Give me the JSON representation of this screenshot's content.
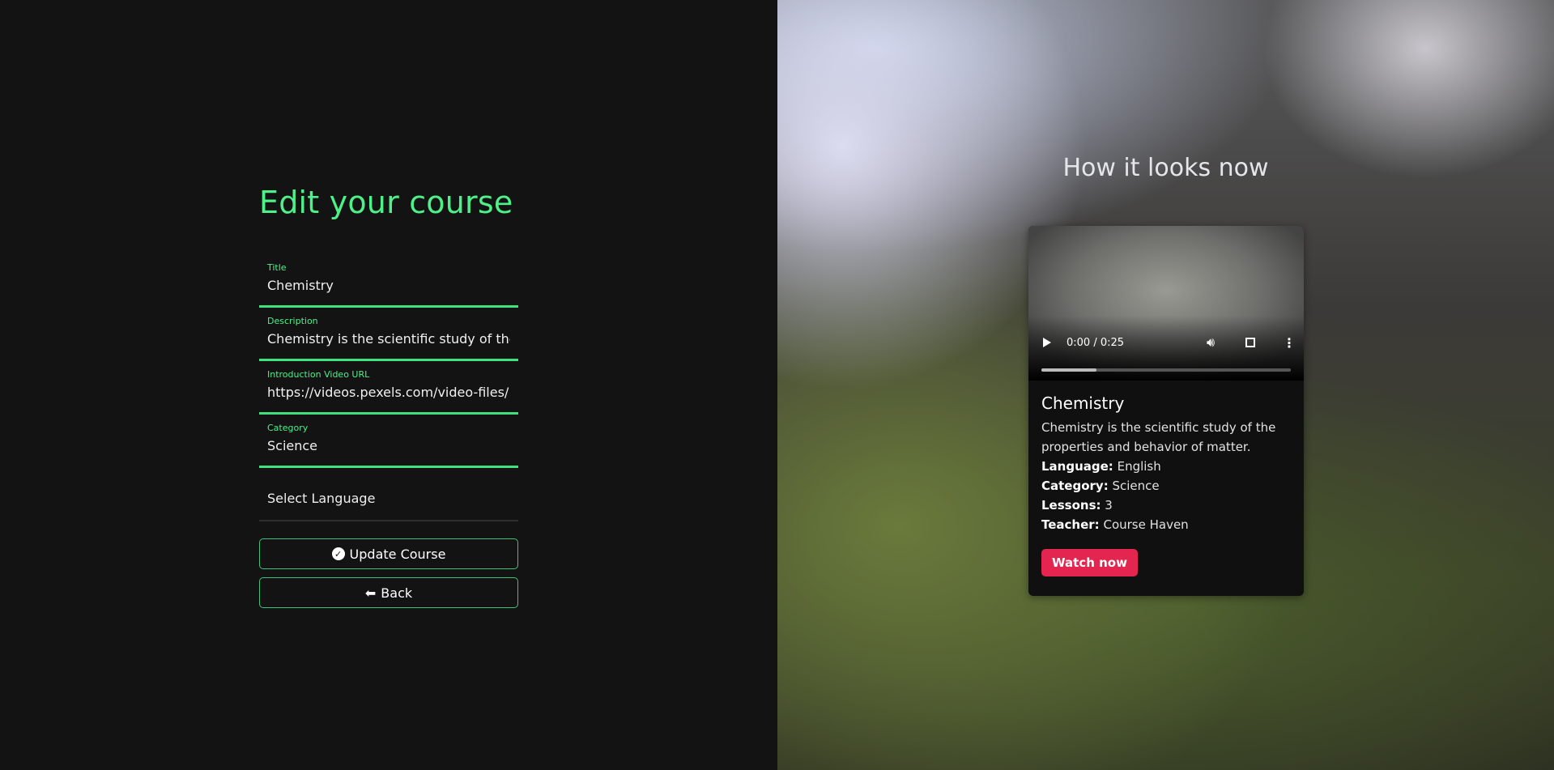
{
  "form": {
    "heading": "Edit your course",
    "fields": [
      {
        "label": "Title",
        "value": "Chemistry"
      },
      {
        "label": "Description",
        "value": "Chemistry is the scientific study of the properties and behavior of matter."
      },
      {
        "label": "Introduction Video URL",
        "value": "https://videos.pexels.com/video-files/"
      },
      {
        "label": "Category",
        "value": "Science"
      }
    ],
    "language_select": "Select Language",
    "update_label": "Update Course",
    "back_label": "Back"
  },
  "preview": {
    "heading": "How it looks now",
    "video": {
      "time": "0:00 / 0:25",
      "progress": 0.22
    },
    "title": "Chemistry",
    "description": "Chemistry is the scientific study of the properties and behavior of matter.",
    "meta": [
      {
        "key": "Language:",
        "value": "English"
      },
      {
        "key": "Category:",
        "value": "Science"
      },
      {
        "key": "Lessons:",
        "value": "3"
      },
      {
        "key": "Teacher:",
        "value": "Course Haven"
      }
    ],
    "watch_label": "Watch now"
  },
  "colors": {
    "accent": "#4ef08a",
    "watch": "#e4254f"
  }
}
